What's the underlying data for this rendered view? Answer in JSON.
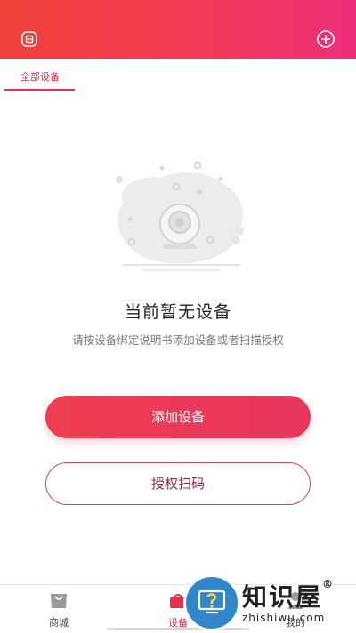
{
  "header": {
    "left_icon": "back-icon",
    "right_icon": "add-circle-icon"
  },
  "tabs": [
    {
      "label": "全部设备",
      "active": true
    }
  ],
  "empty_state": {
    "illustration": "camera-illustration",
    "title": "当前暂无设备",
    "description": "请按设备绑定说明书添加设备或者扫描授权"
  },
  "buttons": {
    "add_device": "添加设备",
    "authorize_scan": "授权扫码"
  },
  "bottom_nav": [
    {
      "label": "商城",
      "icon": "shopping-bag-icon"
    },
    {
      "label": "设备",
      "icon": "device-icon",
      "active": true
    },
    {
      "label": "我的",
      "icon": "user-icon"
    }
  ],
  "watermark": {
    "brand": "知识屋",
    "registered": "®",
    "domain": "zhishiwu.com"
  },
  "colors": {
    "accent": "#e8304d",
    "header_start": "#f0403a",
    "header_end": "#ee2e7a"
  }
}
